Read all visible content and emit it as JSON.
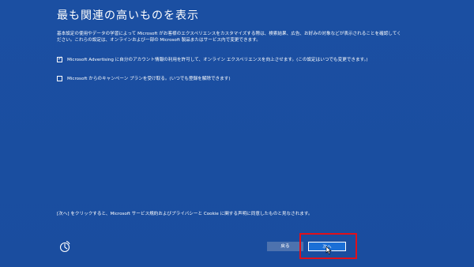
{
  "page": {
    "title": "最も関連の高いものを表示",
    "description": "基本設定の使用やデータの学習によって Microsoft がお客様のエクスペリエンスをカスタマイズする際は、検索結果、広告、お好みの対象などが表示されることを確認してください。これらの設定は、オンラインおよび一部の Microsoft 製品またはサービス内で変更できます。"
  },
  "options": [
    {
      "label": "Microsoft Advertising に自分のアカウント情報の利用を許可して、オンライン エクスペリエンスを向上させます。(この設定はいつでも変更できます。)",
      "checked": true
    },
    {
      "label": "Microsoft からのキャンペーン プランを受け取る。(いつでも登録を解除できます)",
      "checked": false
    }
  ],
  "footer": {
    "note": "[次へ] をクリックすると、Microsoft サービス規約およびプライバシーと Cookie に関する声明に同意したものと見なされます。"
  },
  "buttons": {
    "back_label": "戻る",
    "next_label": "次へ"
  },
  "icons": {
    "ease_of_access": "ease-of-access-icon",
    "check": "check-icon",
    "cursor": "mouse-cursor-icon"
  },
  "colors": {
    "background": "#1a4ea0",
    "next_button": "#1b6fd6",
    "back_button": "#4d72ae",
    "highlight": "#e0101a"
  }
}
